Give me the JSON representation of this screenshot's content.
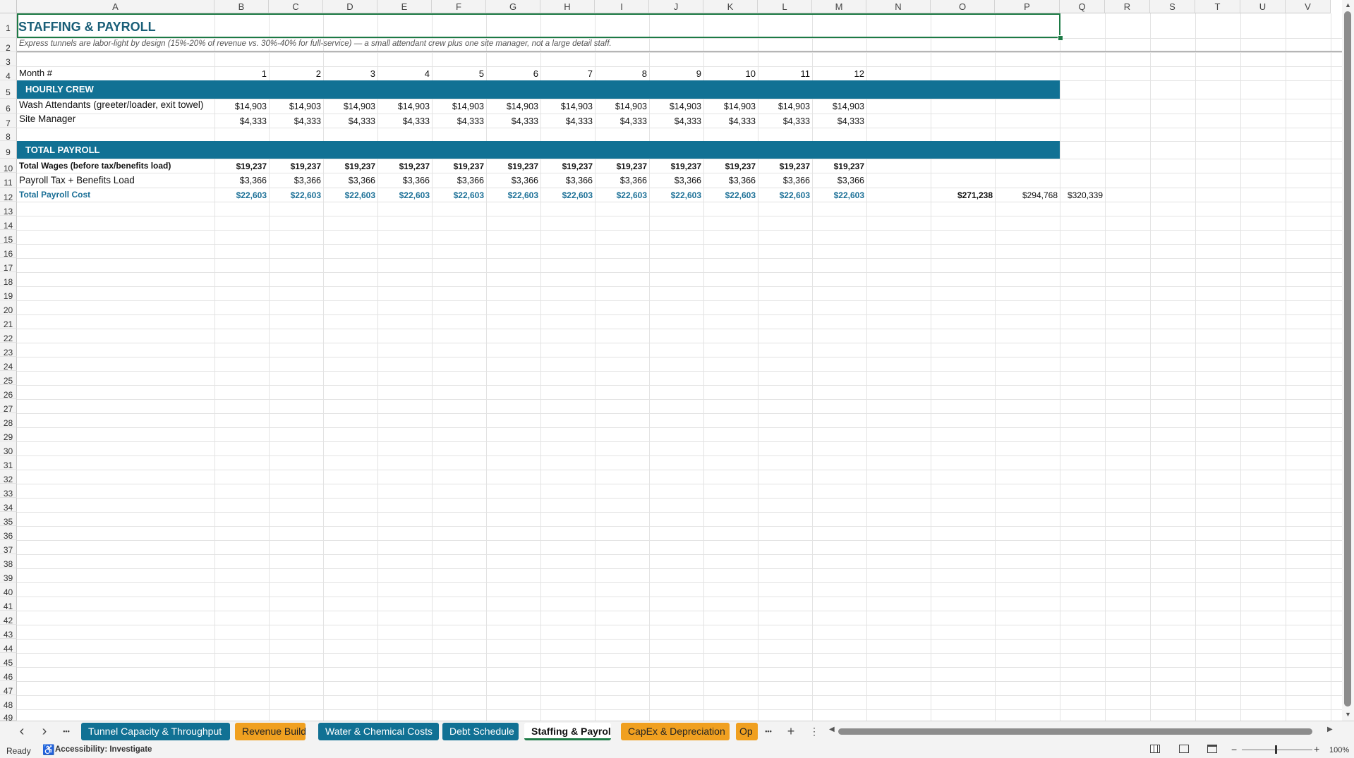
{
  "columns": [
    "A",
    "B",
    "C",
    "D",
    "E",
    "F",
    "G",
    "H",
    "I",
    "J",
    "K",
    "L",
    "M",
    "N",
    "O",
    "P",
    "Q",
    "R",
    "S",
    "T",
    "U",
    "V"
  ],
  "row_numbers": [
    "1",
    "2",
    "3",
    "4",
    "5",
    "6",
    "7",
    "8",
    "9",
    "10",
    "11",
    "12",
    "13",
    "14",
    "15",
    "16",
    "17",
    "18",
    "19",
    "20",
    "21",
    "22",
    "23",
    "24",
    "25",
    "26",
    "27",
    "28",
    "29",
    "30",
    "31",
    "32",
    "33",
    "34",
    "35",
    "36",
    "37",
    "38",
    "39",
    "40",
    "41",
    "42",
    "43",
    "44",
    "45",
    "46",
    "47",
    "48",
    "49"
  ],
  "sheet": {
    "title": "STAFFING & PAYROLL",
    "subtitle": "Express tunnels are labor-light by design (15%-20% of revenue vs. 30%-40% for full-service) — a small attendant crew plus one site manager, not a large detail staff.",
    "month_label": "Month #",
    "months": [
      "1",
      "2",
      "3",
      "4",
      "5",
      "6",
      "7",
      "8",
      "9",
      "10",
      "11",
      "12"
    ],
    "section_hourly": "HOURLY CREW",
    "row_wash": {
      "label": "Wash Attendants (greeter/loader, exit towel)",
      "values": [
        "$14,903",
        "$14,903",
        "$14,903",
        "$14,903",
        "$14,903",
        "$14,903",
        "$14,903",
        "$14,903",
        "$14,903",
        "$14,903",
        "$14,903",
        "$14,903"
      ]
    },
    "row_manager": {
      "label": "Site Manager",
      "values": [
        "$4,333",
        "$4,333",
        "$4,333",
        "$4,333",
        "$4,333",
        "$4,333",
        "$4,333",
        "$4,333",
        "$4,333",
        "$4,333",
        "$4,333",
        "$4,333"
      ]
    },
    "section_total": "TOTAL PAYROLL",
    "row_wages": {
      "label": "Total Wages (before tax/benefits load)",
      "values": [
        "$19,237",
        "$19,237",
        "$19,237",
        "$19,237",
        "$19,237",
        "$19,237",
        "$19,237",
        "$19,237",
        "$19,237",
        "$19,237",
        "$19,237",
        "$19,237"
      ]
    },
    "row_tax": {
      "label": "Payroll Tax + Benefits Load",
      "values": [
        "$3,366",
        "$3,366",
        "$3,366",
        "$3,366",
        "$3,366",
        "$3,366",
        "$3,366",
        "$3,366",
        "$3,366",
        "$3,366",
        "$3,366",
        "$3,366"
      ]
    },
    "row_total": {
      "label": "Total Payroll Cost",
      "values": [
        "$22,603",
        "$22,603",
        "$22,603",
        "$22,603",
        "$22,603",
        "$22,603",
        "$22,603",
        "$22,603",
        "$22,603",
        "$22,603",
        "$22,603",
        "$22,603"
      ],
      "year_totals": [
        "$271,238",
        "$294,768",
        "$320,339"
      ]
    }
  },
  "tabs": [
    {
      "label": "Tunnel Capacity & Throughput",
      "color": "blue"
    },
    {
      "label": "Revenue Build",
      "color": "orange"
    },
    {
      "label": "Water & Chemical Costs",
      "color": "blue"
    },
    {
      "label": "Debt Schedule",
      "color": "blue"
    },
    {
      "label": "Staffing & Payroll",
      "color": "active"
    },
    {
      "label": "CapEx & Depreciation",
      "color": "orange"
    },
    {
      "label": "Op",
      "color": "orange"
    }
  ],
  "tab_nav": {
    "prev": "‹",
    "next": "›",
    "more": "•••",
    "add": "+",
    "options": "⋮"
  },
  "status": {
    "ready": "Ready",
    "accessibility": "Accessibility: Investigate",
    "zoom": "100%"
  },
  "colors": {
    "band": "#117194",
    "accent_text": "#1a6f96",
    "selection": "#1d7a45",
    "tab_orange": "#f0a020"
  }
}
